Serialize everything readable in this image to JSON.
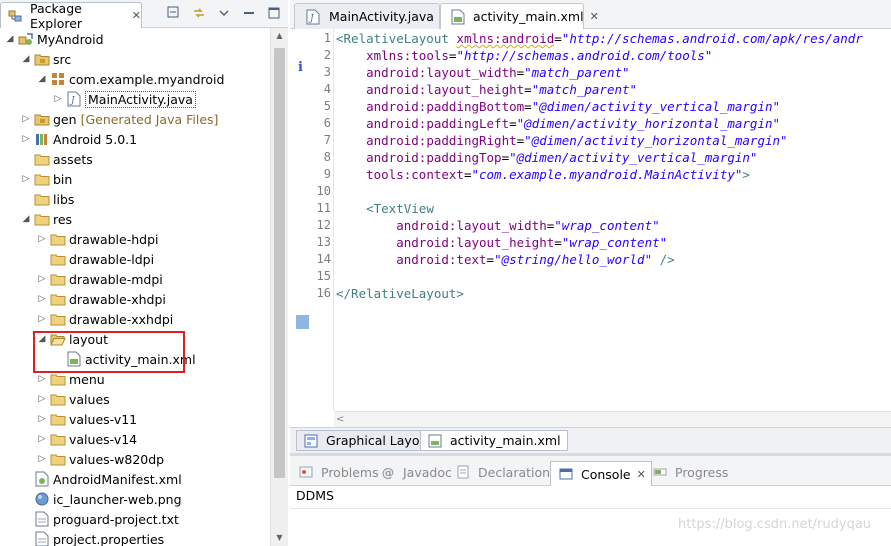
{
  "package_explorer": {
    "title": "Package Explorer",
    "tree": [
      {
        "label": "MyAndroid",
        "indent": 0,
        "twisty": "open",
        "icon": "android-project-icon"
      },
      {
        "label": "src",
        "indent": 1,
        "twisty": "open",
        "icon": "source-folder-icon"
      },
      {
        "label": "com.example.myandroid",
        "indent": 2,
        "twisty": "open",
        "icon": "package-icon"
      },
      {
        "label": "MainActivity.java",
        "indent": 3,
        "twisty": "closed",
        "icon": "java-file-icon",
        "selected": true
      },
      {
        "label": "gen",
        "indent": 1,
        "twisty": "closed",
        "icon": "source-folder-icon",
        "decoration": "[Generated Java Files]"
      },
      {
        "label": "Android 5.0.1",
        "indent": 1,
        "twisty": "closed",
        "icon": "library-icon"
      },
      {
        "label": "assets",
        "indent": 1,
        "twisty": "none",
        "icon": "folder-icon"
      },
      {
        "label": "bin",
        "indent": 1,
        "twisty": "closed",
        "icon": "folder-icon"
      },
      {
        "label": "libs",
        "indent": 1,
        "twisty": "none",
        "icon": "folder-icon"
      },
      {
        "label": "res",
        "indent": 1,
        "twisty": "open",
        "icon": "folder-icon"
      },
      {
        "label": "drawable-hdpi",
        "indent": 2,
        "twisty": "closed",
        "icon": "folder-icon"
      },
      {
        "label": "drawable-ldpi",
        "indent": 2,
        "twisty": "none",
        "icon": "folder-icon"
      },
      {
        "label": "drawable-mdpi",
        "indent": 2,
        "twisty": "closed",
        "icon": "folder-icon"
      },
      {
        "label": "drawable-xhdpi",
        "indent": 2,
        "twisty": "closed",
        "icon": "folder-icon"
      },
      {
        "label": "drawable-xxhdpi",
        "indent": 2,
        "twisty": "closed",
        "icon": "folder-icon"
      },
      {
        "label": "layout",
        "indent": 2,
        "twisty": "open",
        "icon": "folder-open-icon"
      },
      {
        "label": "activity_main.xml",
        "indent": 3,
        "twisty": "none",
        "icon": "xml-file-icon"
      },
      {
        "label": "menu",
        "indent": 2,
        "twisty": "closed",
        "icon": "folder-icon"
      },
      {
        "label": "values",
        "indent": 2,
        "twisty": "closed",
        "icon": "folder-icon"
      },
      {
        "label": "values-v11",
        "indent": 2,
        "twisty": "closed",
        "icon": "folder-icon"
      },
      {
        "label": "values-v14",
        "indent": 2,
        "twisty": "closed",
        "icon": "folder-icon"
      },
      {
        "label": "values-w820dp",
        "indent": 2,
        "twisty": "closed",
        "icon": "folder-icon"
      },
      {
        "label": "AndroidManifest.xml",
        "indent": 1,
        "twisty": "none",
        "icon": "manifest-file-icon"
      },
      {
        "label": "ic_launcher-web.png",
        "indent": 1,
        "twisty": "none",
        "icon": "image-file-icon"
      },
      {
        "label": "proguard-project.txt",
        "indent": 1,
        "twisty": "none",
        "icon": "text-file-icon"
      },
      {
        "label": "project.properties",
        "indent": 1,
        "twisty": "none",
        "icon": "text-file-icon"
      }
    ]
  },
  "editor": {
    "tabs": [
      {
        "label": "MainActivity.java",
        "icon": "java-file-icon",
        "active": false
      },
      {
        "label": "activity_main.xml",
        "icon": "xml-file-icon",
        "active": true
      }
    ],
    "line_numbers": [
      "1",
      "2",
      "3",
      "4",
      "5",
      "6",
      "7",
      "8",
      "9",
      "10",
      "11",
      "12",
      "13",
      "14",
      "15",
      "16"
    ],
    "lines": [
      [
        {
          "t": "tag",
          "s": "<RelativeLayout"
        },
        {
          "t": "plain",
          "s": " "
        },
        {
          "t": "attr squig",
          "s": "xmlns:android"
        },
        {
          "t": "eq",
          "s": "="
        },
        {
          "t": "val",
          "s": "\"http://schemas.android.com/apk/res/andr"
        }
      ],
      [
        {
          "t": "plain",
          "s": "    "
        },
        {
          "t": "attr",
          "s": "xmlns:tools"
        },
        {
          "t": "eq",
          "s": "="
        },
        {
          "t": "val",
          "s": "\"http://schemas.android.com/tools\""
        }
      ],
      [
        {
          "t": "plain",
          "s": "    "
        },
        {
          "t": "attr",
          "s": "android:layout_width"
        },
        {
          "t": "eq",
          "s": "="
        },
        {
          "t": "val",
          "s": "\"match_parent\""
        }
      ],
      [
        {
          "t": "plain",
          "s": "    "
        },
        {
          "t": "attr",
          "s": "android:layout_height"
        },
        {
          "t": "eq",
          "s": "="
        },
        {
          "t": "val",
          "s": "\"match_parent\""
        }
      ],
      [
        {
          "t": "plain",
          "s": "    "
        },
        {
          "t": "attr",
          "s": "android:paddingBottom"
        },
        {
          "t": "eq",
          "s": "="
        },
        {
          "t": "val",
          "s": "\"@dimen/activity_vertical_margin\""
        }
      ],
      [
        {
          "t": "plain",
          "s": "    "
        },
        {
          "t": "attr",
          "s": "android:paddingLeft"
        },
        {
          "t": "eq",
          "s": "="
        },
        {
          "t": "val",
          "s": "\"@dimen/activity_horizontal_margin\""
        }
      ],
      [
        {
          "t": "plain",
          "s": "    "
        },
        {
          "t": "attr",
          "s": "android:paddingRight"
        },
        {
          "t": "eq",
          "s": "="
        },
        {
          "t": "val",
          "s": "\"@dimen/activity_horizontal_margin\""
        }
      ],
      [
        {
          "t": "plain",
          "s": "    "
        },
        {
          "t": "attr",
          "s": "android:paddingTop"
        },
        {
          "t": "eq",
          "s": "="
        },
        {
          "t": "val",
          "s": "\"@dimen/activity_vertical_margin\""
        }
      ],
      [
        {
          "t": "plain",
          "s": "    "
        },
        {
          "t": "attr",
          "s": "tools:context"
        },
        {
          "t": "eq",
          "s": "="
        },
        {
          "t": "val",
          "s": "\"com.example.myandroid.MainActivity\""
        },
        {
          "t": "bracket",
          "s": ">"
        }
      ],
      [],
      [
        {
          "t": "plain",
          "s": "    "
        },
        {
          "t": "tag",
          "s": "<TextView"
        }
      ],
      [
        {
          "t": "plain",
          "s": "        "
        },
        {
          "t": "attr",
          "s": "android:layout_width"
        },
        {
          "t": "eq",
          "s": "="
        },
        {
          "t": "val",
          "s": "\"wrap_content\""
        }
      ],
      [
        {
          "t": "plain",
          "s": "        "
        },
        {
          "t": "attr",
          "s": "android:layout_height"
        },
        {
          "t": "eq",
          "s": "="
        },
        {
          "t": "val",
          "s": "\"wrap_content\""
        }
      ],
      [
        {
          "t": "plain",
          "s": "        "
        },
        {
          "t": "attr",
          "s": "android:text"
        },
        {
          "t": "eq",
          "s": "="
        },
        {
          "t": "val",
          "s": "\"@string/hello_world\""
        },
        {
          "t": "plain",
          "s": " "
        },
        {
          "t": "bracket",
          "s": "/>"
        }
      ],
      [],
      [
        {
          "t": "tag",
          "s": "</RelativeLayout>"
        }
      ]
    ],
    "bottom_tabs": [
      {
        "label": "Graphical Layout",
        "icon": "graphical-layout-icon",
        "active": false
      },
      {
        "label": "activity_main.xml",
        "icon": "xml-file-icon",
        "active": true
      }
    ]
  },
  "console_view": {
    "tabs": [
      {
        "label": "Problems",
        "icon": "problems-icon",
        "active": false
      },
      {
        "label": "Javadoc",
        "icon": "javadoc-icon",
        "active": false
      },
      {
        "label": "Declaration",
        "icon": "declaration-icon",
        "active": false
      },
      {
        "label": "Console",
        "icon": "console-icon",
        "active": true
      },
      {
        "label": "Progress",
        "icon": "progress-icon",
        "active": false
      }
    ],
    "body_text": "DDMS",
    "watermark": "https://blog.csdn.net/rudyqau"
  },
  "colors": {
    "tag": "#3f7f7f",
    "attribute": "#7f007f",
    "value": "#2a00ff",
    "highlight_box": "#e02020"
  }
}
